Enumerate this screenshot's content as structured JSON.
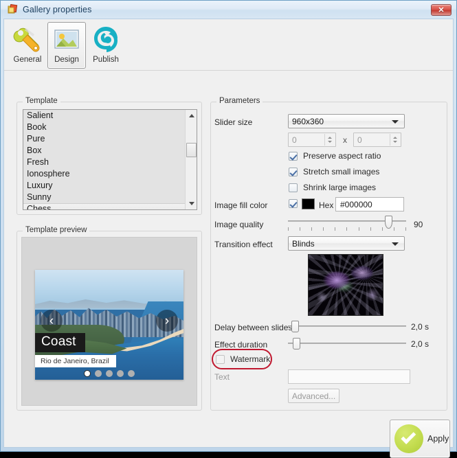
{
  "window": {
    "title": "Gallery properties",
    "title_icon": "gallery-icon",
    "close_label": "✕"
  },
  "toolbar": {
    "items": [
      {
        "label": "General",
        "icon": "wrench-icon",
        "selected": false
      },
      {
        "label": "Design",
        "icon": "picture-icon",
        "selected": true
      },
      {
        "label": "Publish",
        "icon": "globe-icon",
        "selected": false
      }
    ]
  },
  "template_group": {
    "title": "Template",
    "items": [
      {
        "name": "Salient",
        "selected": false
      },
      {
        "name": "Book",
        "selected": false
      },
      {
        "name": "Pure",
        "selected": false
      },
      {
        "name": "Box",
        "selected": false
      },
      {
        "name": "Fresh",
        "selected": false
      },
      {
        "name": "Ionosphere",
        "selected": false
      },
      {
        "name": "Luxury",
        "selected": false
      },
      {
        "name": "Sunny",
        "selected": false
      },
      {
        "name": "Chess",
        "selected": true
      }
    ]
  },
  "preview_group": {
    "title": "Template preview",
    "slide_title": "Coast",
    "slide_caption": "Rio de Janeiro, Brazil",
    "prev_arrow": "‹",
    "next_arrow": "›",
    "dots_total": 5,
    "dot_active_index": 0
  },
  "parameters": {
    "title": "Parameters",
    "slider_size": {
      "label": "Slider size",
      "value": "960x360",
      "options": [
        "960x360"
      ]
    },
    "custom_size": {
      "width_value": "0",
      "height_value": "0",
      "separator": "x"
    },
    "checkboxes": [
      {
        "label": "Preserve aspect ratio",
        "checked": true,
        "enabled": true
      },
      {
        "label": "Stretch small images",
        "checked": true,
        "enabled": true
      },
      {
        "label": "Shrink large images",
        "checked": false,
        "enabled": true
      }
    ],
    "image_fill_color": {
      "label": "Image fill color",
      "checked": true,
      "swatch_hex": "#000000",
      "hex_label": "Hex",
      "hex_value": "#000000"
    },
    "image_quality": {
      "label": "Image quality",
      "value": "90",
      "percent": 84
    },
    "transition_effect": {
      "label": "Transition effect",
      "value": "Blinds",
      "options": [
        "Blinds"
      ],
      "preview_name": "fractal-preview"
    },
    "delay_between_slides": {
      "label": "Delay between slides",
      "value": "2,0 s",
      "percent": 3
    },
    "effect_duration": {
      "label": "Effect duration",
      "value": "2,0 s",
      "percent": 4
    },
    "watermark": {
      "label": "Watermark",
      "checked": false,
      "highlighted": true
    },
    "watermark_text": {
      "label": "Text",
      "value": "",
      "enabled": false
    },
    "advanced_button": {
      "label": "Advanced...",
      "enabled": false
    }
  },
  "footer": {
    "apply_label": "Apply",
    "apply_icon": "check-icon"
  },
  "colors": {
    "accent_blue": "#6d9fc4",
    "annotation_red": "#c0182f",
    "apply_green": "#c3dc4f",
    "fill_black": "#000000"
  }
}
